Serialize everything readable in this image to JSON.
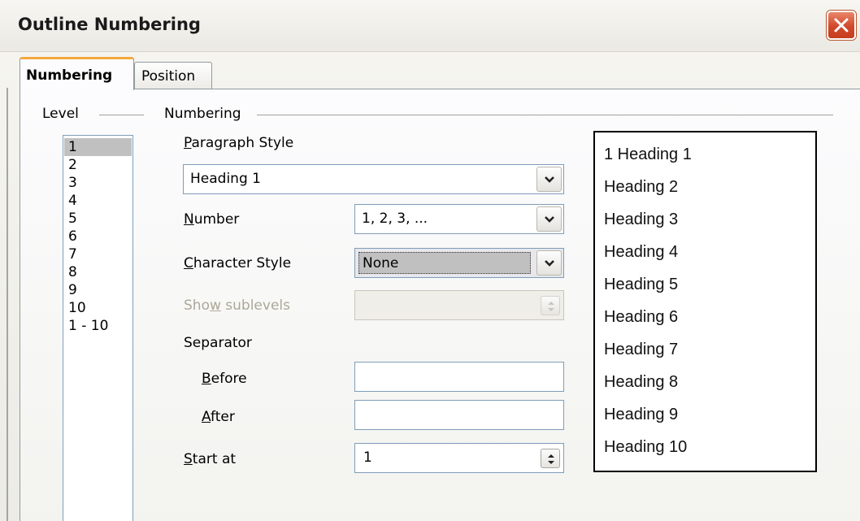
{
  "window": {
    "title": "Outline Numbering"
  },
  "tabs": [
    {
      "label": "Numbering",
      "active": true
    },
    {
      "label": "Position",
      "active": false
    }
  ],
  "level_group": {
    "label": "Level",
    "items": [
      "1",
      "2",
      "3",
      "4",
      "5",
      "6",
      "7",
      "8",
      "9",
      "10",
      "1 - 10"
    ],
    "selected": "1"
  },
  "numbering_group": {
    "label": "Numbering",
    "paragraph_style": {
      "label_underlined": "P",
      "label_rest": "aragraph Style",
      "value": "Heading 1"
    },
    "number": {
      "label_underlined": "N",
      "label_rest": "umber",
      "value": "1, 2, 3, ..."
    },
    "character_style": {
      "label_underlined": "C",
      "label_rest": "haracter Style",
      "value": "None"
    },
    "show_sublevels": {
      "label_pre": "Sho",
      "label_underlined": "w",
      "label_rest": " sublevels",
      "value": ""
    },
    "separator": {
      "label": "Separator",
      "before": {
        "label_underlined": "B",
        "label_rest": "efore",
        "value": ""
      },
      "after": {
        "label_underlined": "A",
        "label_rest": "fter",
        "value": ""
      }
    },
    "start_at": {
      "label_underlined": "S",
      "label_rest": "tart at",
      "value": "1"
    }
  },
  "preview": {
    "lines": [
      "1 Heading 1",
      "Heading 2",
      "Heading 3",
      "Heading 4",
      "Heading 5",
      "Heading 6",
      "Heading 7",
      "Heading 8",
      "Heading 9",
      "Heading 10"
    ]
  },
  "colors": {
    "active_tab_accent": "#f4a840",
    "close_button": "#d2482a",
    "input_border": "#7f9db9",
    "selected_level": "#c0c0c0"
  },
  "icons": [
    "close-icon",
    "chevron-down-icon",
    "spin-arrows-icon"
  ]
}
